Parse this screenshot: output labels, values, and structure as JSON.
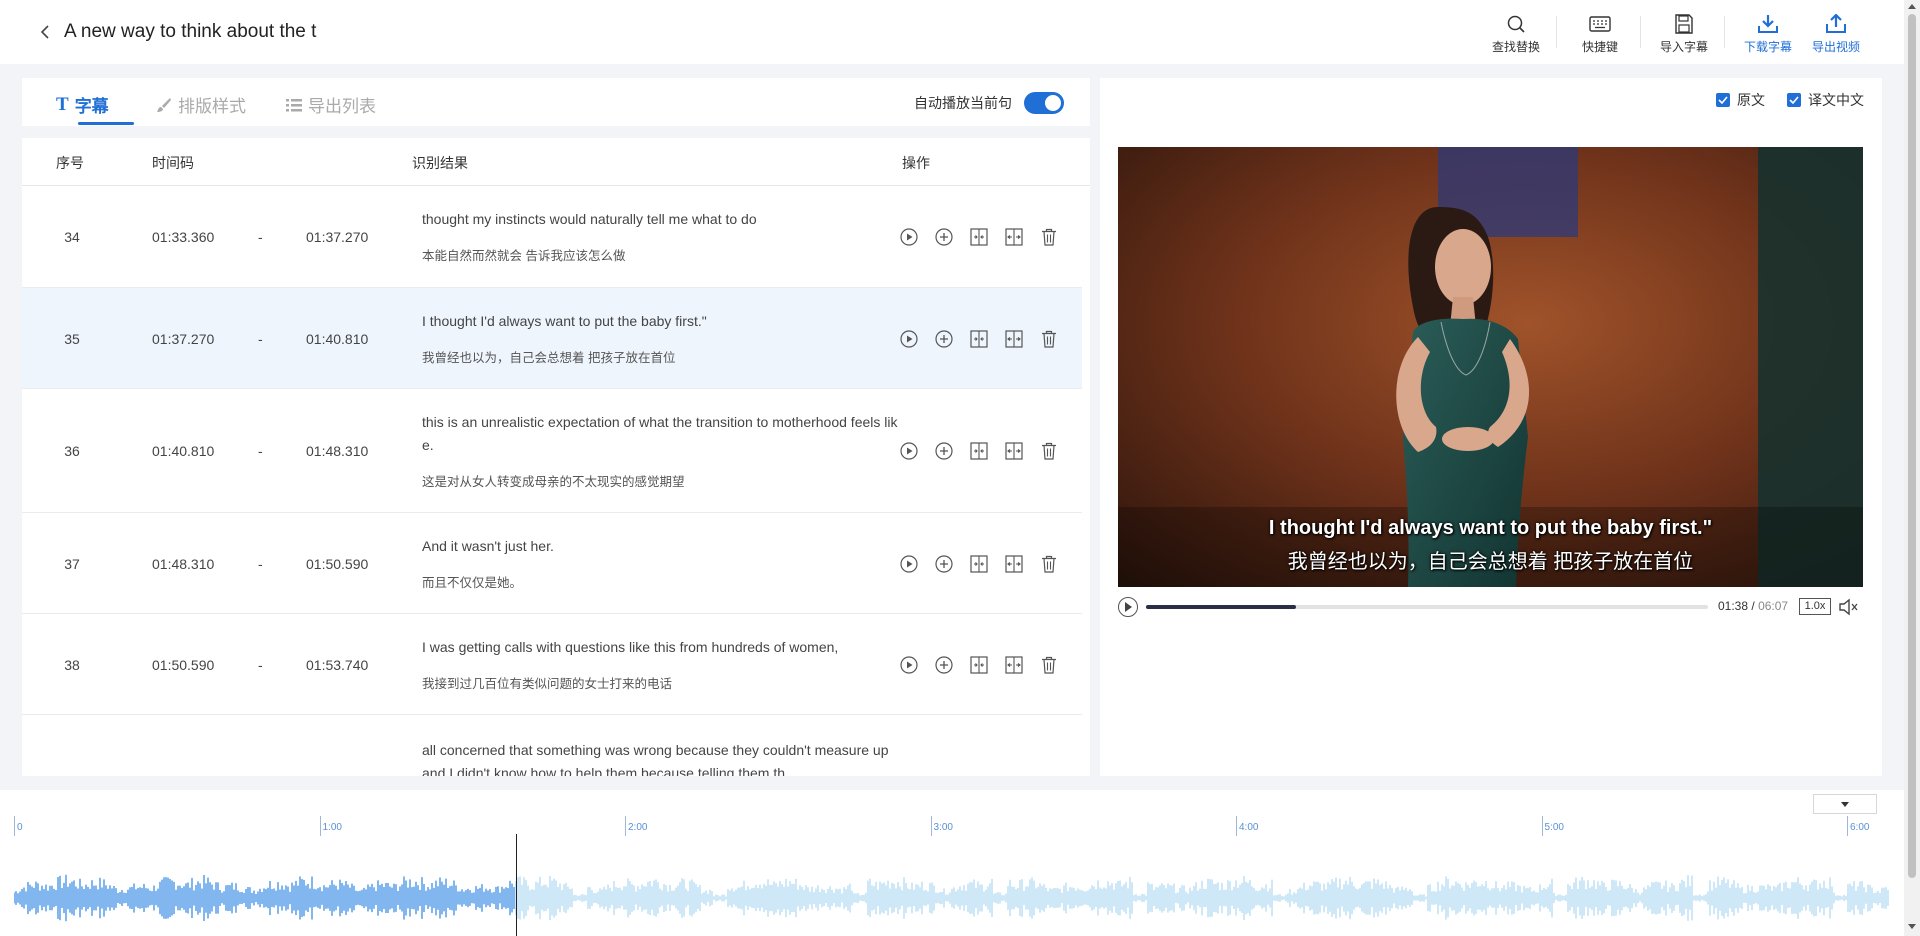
{
  "header": {
    "title": "A new way to think about the t",
    "tools": [
      {
        "label": "查找替换",
        "icon": "search-icon"
      },
      {
        "label": "快捷键",
        "icon": "keyboard-icon"
      },
      {
        "label": "导入字幕",
        "icon": "save-icon"
      },
      {
        "label": "下载字幕",
        "icon": "download-icon"
      },
      {
        "label": "导出视频",
        "icon": "export-icon"
      }
    ]
  },
  "tabs": [
    {
      "label": "字幕",
      "icon": "text-icon",
      "active": true
    },
    {
      "label": "排版样式",
      "icon": "brush-icon",
      "active": false
    },
    {
      "label": "导出列表",
      "icon": "list-icon",
      "active": false
    }
  ],
  "autoplay": {
    "label": "自动播放当前句",
    "on": true
  },
  "table": {
    "headers": {
      "index": "序号",
      "timecode": "时间码",
      "result": "识别结果",
      "actions": "操作"
    },
    "rows": [
      {
        "num": "34",
        "start": "01:33.360",
        "dash": "-",
        "end": "01:37.270",
        "en": "thought my instincts would naturally tell me what to do",
        "zh": "本能自然而然就会 告诉我应该怎么做",
        "active": false
      },
      {
        "num": "35",
        "start": "01:37.270",
        "dash": "-",
        "end": "01:40.810",
        "en": "I thought I'd always want to put the baby first.\"",
        "zh": "我曾经也以为，自己会总想着 把孩子放在首位",
        "active": true
      },
      {
        "num": "36",
        "start": "01:40.810",
        "dash": "-",
        "end": "01:48.310",
        "en": "this is an unrealistic expectation of what the transition to motherhood feels like.",
        "zh": "这是对从女人转变成母亲的不太现实的感觉期望",
        "active": false
      },
      {
        "num": "37",
        "start": "01:48.310",
        "dash": "-",
        "end": "01:50.590",
        "en": "And it wasn't just her.",
        "zh": "而且不仅仅是她。",
        "active": false
      },
      {
        "num": "38",
        "start": "01:50.590",
        "dash": "-",
        "end": "01:53.740",
        "en": "I was getting calls with questions like this from hundreds of women,",
        "zh": "我接到过几百位有类似问题的女士打来的电话",
        "active": false
      },
      {
        "num": "",
        "start": "",
        "dash": "",
        "end": "",
        "en": "all concerned that something was wrong because they couldn't measure up and I didn't know how to help them because telling them th",
        "zh": "",
        "active": false
      }
    ]
  },
  "preview": {
    "options": [
      {
        "label": "原文",
        "checked": true
      },
      {
        "label": "译文中文",
        "checked": true
      }
    ],
    "subtitle_en": "I thought I'd always want to put the baby first.\"",
    "subtitle_zh": "我曾经也以为，自己会总想着 把孩子放在首位",
    "current_time": "01:38",
    "separator": "/",
    "duration": "06:07",
    "speed": "1.0x",
    "progress": 0.267
  },
  "timeline": {
    "ticks": [
      "0",
      "1:00",
      "2:00",
      "3:00",
      "4:00",
      "5:00",
      "6:00"
    ],
    "played_fraction": 0.267
  },
  "colors": {
    "accent": "#1f6fd6",
    "wave_played": "#3d8fe6",
    "wave_unplayed": "#b3dcf3"
  }
}
